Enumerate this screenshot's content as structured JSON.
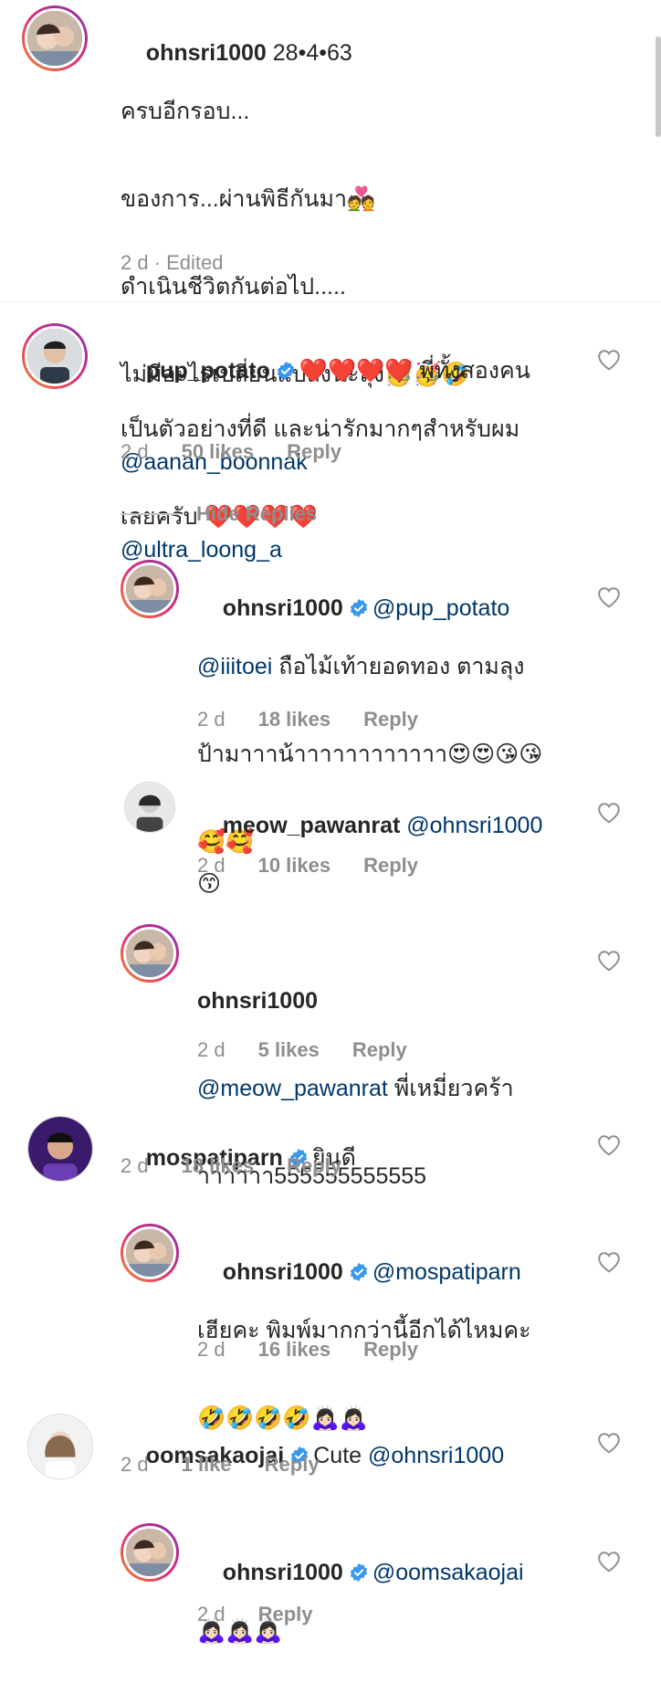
{
  "caption": {
    "username": "ohnsri1000",
    "date": "28•4•63",
    "line1": "ครบอีกรอบ...",
    "line2": "ของการ...ผ่านพิธีกันมา💑",
    "line3": "ดำเนินชีวิตกันต่อไป.....",
    "line4": "ไม่มีอะไรเปลี่ยนแปลงนะลุง🥳🥳🤣",
    "mention1": "@aanan_boonnak",
    "mention2": "@ultra_loong_a",
    "meta": "2 d · Edited"
  },
  "c1": {
    "username": "pup_potato",
    "hearts": "❤️❤️❤️❤️",
    "text_a": " พี่ทั้งสองคน",
    "text_b": "เป็นตัวอย่างที่ดี และน่ารักมากๆสำหรับผม",
    "text_c": "เลยครับ ❤️❤️❤️❤️",
    "time": "2 d",
    "likes": "50 likes",
    "reply": "Reply"
  },
  "hide_replies": "Hide Replies",
  "r1": {
    "username": "ohnsri1000",
    "mention": "@pup_potato",
    "mention2": "@iiitoei",
    "text_a": " ถือไม้เท้ายอดทอง ตามลุง",
    "text_b": "ป้ามาาาน้าาาาาาาาาาาา😍😍😘😘",
    "text_c": "🥰🥰",
    "time": "2 d",
    "likes": "18 likes",
    "reply": "Reply"
  },
  "r2": {
    "username": "meow_pawanrat",
    "mention": "@ohnsri1000",
    "text_b": "😙",
    "time": "2 d",
    "likes": "10 likes",
    "reply": "Reply"
  },
  "r3": {
    "username": "ohnsri1000",
    "mention": "@meow_pawanrat",
    "text_a": " พี่เหมี่ยวคร้า",
    "text_b": "าาาาาา555555555555",
    "time": "2 d",
    "likes": "5 likes",
    "reply": "Reply"
  },
  "c2": {
    "username": "mospatiparn",
    "text_a": "ยินดี",
    "time": "2 d",
    "likes": "18 likes",
    "reply": "Reply"
  },
  "r4": {
    "username": "ohnsri1000",
    "mention": "@mospatiparn",
    "text_b": "เฮียคะ พิมพ์มากกว่านี้อีกได้ไหมคะ",
    "text_c": "🤣🤣🤣🤣🙇🏻‍♀️🙇🏻‍♀️",
    "time": "2 d",
    "likes": "16 likes",
    "reply": "Reply"
  },
  "c3": {
    "username": "oomsakaojai",
    "text_a": "Cute ",
    "mention": "@ohnsri1000",
    "time": "2 d",
    "likes": "1 like",
    "reply": "Reply"
  },
  "r5": {
    "username": "ohnsri1000",
    "mention": "@oomsakaojai",
    "text_b": "🙇🏻‍♀️🙇🏻‍♀️🙇🏻‍♀️",
    "time": "2 d",
    "reply": "Reply"
  },
  "colors": {
    "verified": "#3897f0",
    "mention": "#00376b",
    "meta": "#8e8e8e"
  }
}
